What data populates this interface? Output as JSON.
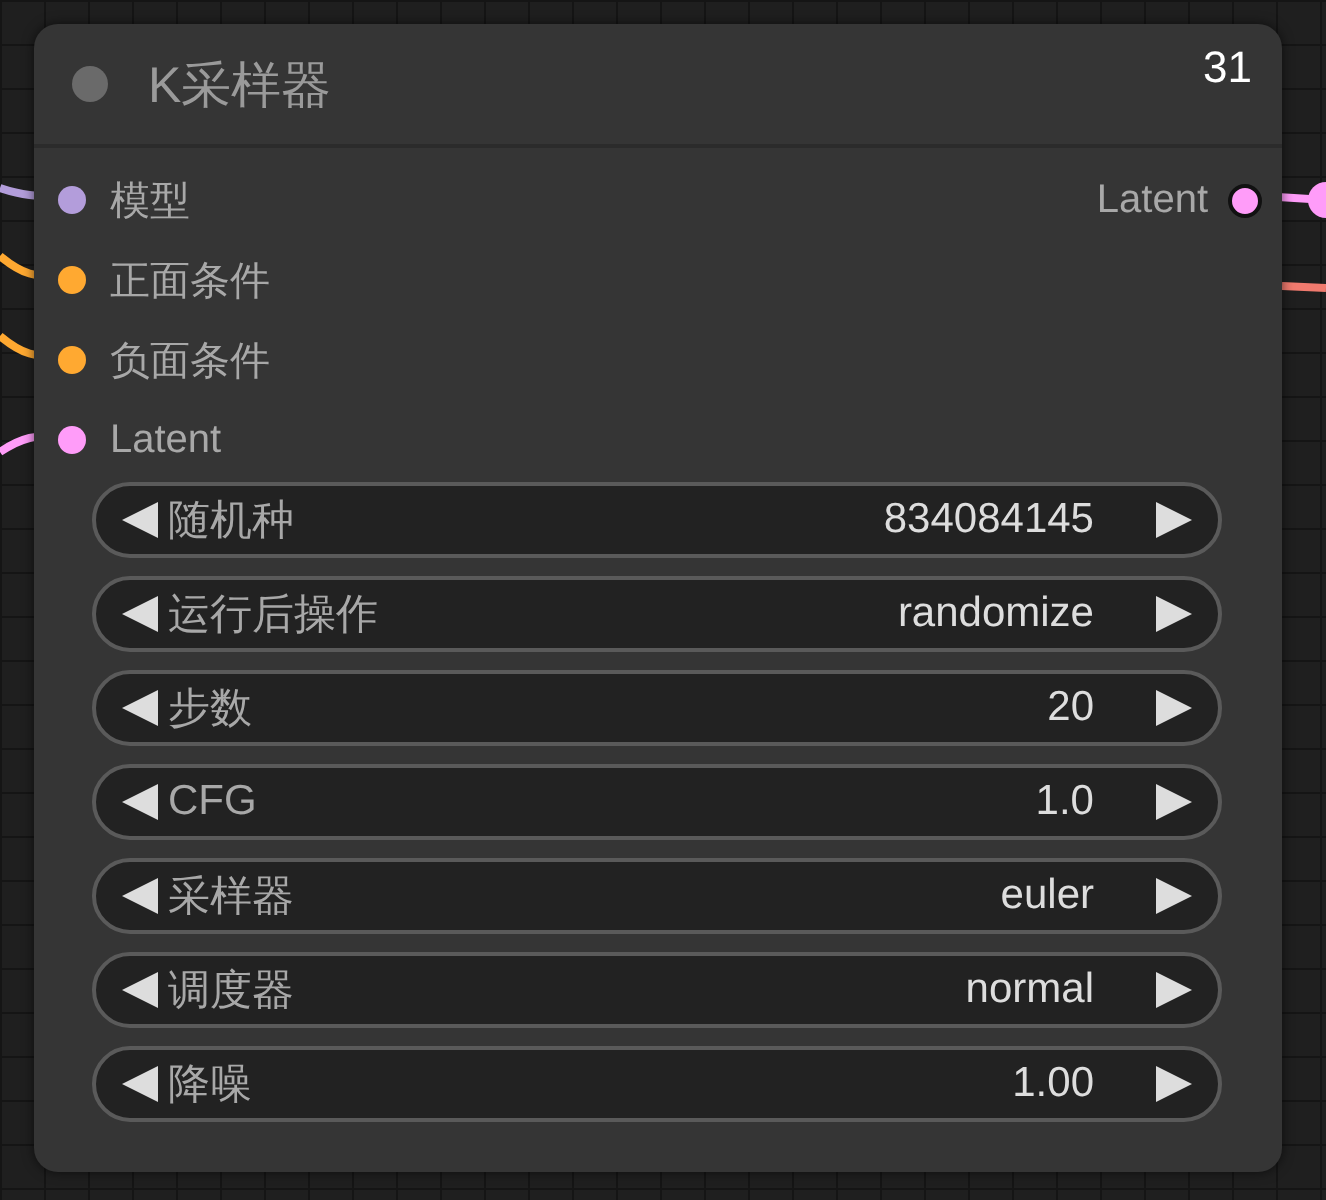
{
  "node": {
    "title": "K采样器",
    "id": "31",
    "inputs": [
      {
        "label": "模型",
        "color": "#b39ddb"
      },
      {
        "label": "正面条件",
        "color": "#ffa931"
      },
      {
        "label": "负面条件",
        "color": "#ffa931"
      },
      {
        "label": "Latent",
        "color": "#ff9cf9"
      }
    ],
    "outputs": [
      {
        "label": "Latent",
        "color": "#ff9cf9"
      }
    ],
    "widgets": [
      {
        "label": "随机种",
        "value": "834084145"
      },
      {
        "label": "运行后操作",
        "value": "randomize"
      },
      {
        "label": "步数",
        "value": "20"
      },
      {
        "label": "CFG",
        "value": "1.0"
      },
      {
        "label": "采样器",
        "value": "euler"
      },
      {
        "label": "调度器",
        "value": "normal"
      },
      {
        "label": "降噪",
        "value": "1.00"
      }
    ]
  }
}
